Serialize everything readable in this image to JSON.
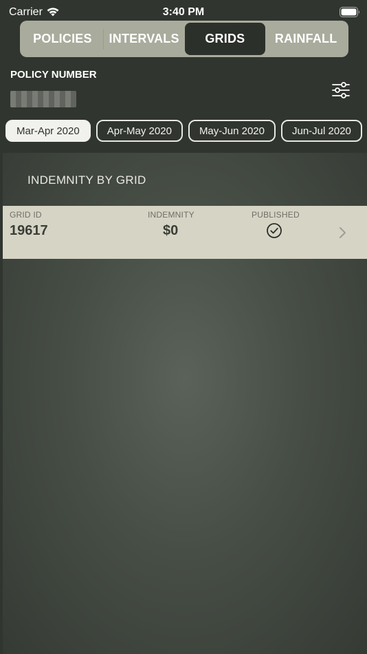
{
  "status_bar": {
    "carrier": "Carrier",
    "time": "3:40 PM"
  },
  "tabs": [
    {
      "label": "POLICIES",
      "active": false
    },
    {
      "label": "INTERVALS",
      "active": false
    },
    {
      "label": "GRIDS",
      "active": true
    },
    {
      "label": "RAINFALL",
      "active": false
    }
  ],
  "policy": {
    "label": "POLICY NUMBER"
  },
  "intervals": [
    {
      "label": "Mar-Apr 2020",
      "selected": true
    },
    {
      "label": "Apr-May 2020",
      "selected": false
    },
    {
      "label": "May-Jun 2020",
      "selected": false
    },
    {
      "label": "Jun-Jul 2020",
      "selected": false
    }
  ],
  "section": {
    "title": "INDEMNITY BY GRID"
  },
  "grid_table": {
    "headers": {
      "grid_id": "GRID ID",
      "indemnity": "INDEMNITY",
      "published": "PUBLISHED"
    },
    "rows": [
      {
        "grid_id": "19617",
        "indemnity": "$0",
        "published_icon": "checkmark-circle-icon"
      }
    ]
  },
  "colors": {
    "background": "#30352f",
    "segment_bg": "#a9ab9c",
    "segment_active": "#2c302b",
    "row_bg": "#d6d4c5"
  }
}
